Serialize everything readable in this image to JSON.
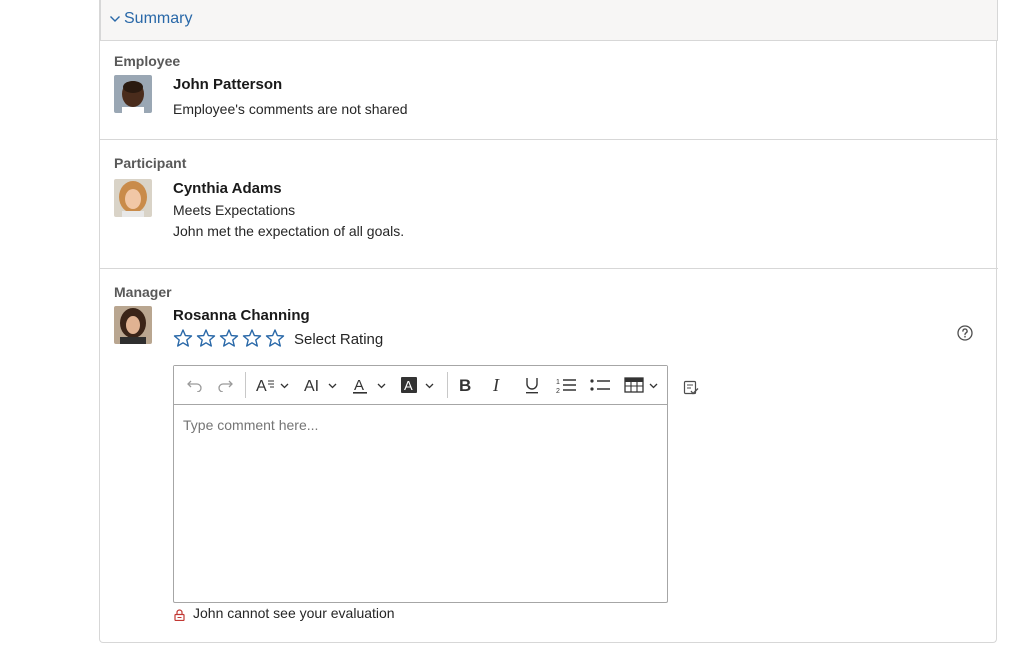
{
  "summary": {
    "title": "Summary"
  },
  "employee": {
    "section_label": "Employee",
    "name": "John Patterson",
    "comment": "Employee's comments are not shared"
  },
  "participant": {
    "section_label": "Participant",
    "name": "Cynthia Adams",
    "rating": "Meets Expectations",
    "comment": "John met the expectation of all goals."
  },
  "manager": {
    "section_label": "Manager",
    "name": "Rosanna Channing",
    "rating_label": "Select Rating",
    "stars_selected": 0,
    "stars_total": 5,
    "comment_placeholder": "Type comment here...",
    "visibility_note": "John cannot see your evaluation"
  },
  "colors": {
    "accent": "#2968a8",
    "star": "#2968a8",
    "lock": "#c23934"
  },
  "toolbar_icons": [
    "undo-icon",
    "redo-icon",
    "paragraph-format-icon",
    "font-size-icon",
    "text-color-icon",
    "background-color-icon",
    "bold-icon",
    "italic-icon",
    "underline-icon",
    "ordered-list-icon",
    "unordered-list-icon",
    "table-icon"
  ]
}
